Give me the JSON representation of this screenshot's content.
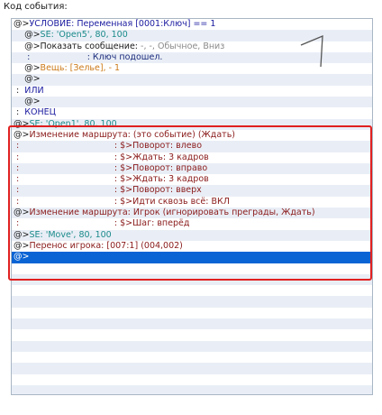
{
  "panel": {
    "title": "Код события:"
  },
  "rows": [
    {
      "bg": "white",
      "segs": [
        [
          "@>",
          "dark"
        ],
        [
          "УСЛОВИЕ: Переменная [0001:Ключ] == 1",
          "blue"
        ]
      ]
    },
    {
      "bg": "alt",
      "segs": [
        [
          "    @>",
          "dark"
        ],
        [
          "SE: 'Open5', 80, 100",
          "teal"
        ]
      ]
    },
    {
      "bg": "white",
      "segs": [
        [
          "    @>Показать сообщение: ",
          "dark"
        ],
        [
          "-, -, Обычное, Вниз",
          "gray"
        ]
      ]
    },
    {
      "bg": "alt",
      "segs": [
        [
          "     :                     : Ключ подошел.",
          "navy"
        ]
      ]
    },
    {
      "bg": "white",
      "segs": [
        [
          "    @>",
          "dark"
        ],
        [
          "Вещь: [Зелье], - 1",
          "orange"
        ]
      ]
    },
    {
      "bg": "alt",
      "segs": [
        [
          "    @>",
          "dark"
        ]
      ]
    },
    {
      "bg": "white",
      "segs": [
        [
          " :  ",
          "dark"
        ],
        [
          "ИЛИ",
          "blue"
        ]
      ]
    },
    {
      "bg": "alt",
      "segs": [
        [
          "    @>",
          "dark"
        ]
      ]
    },
    {
      "bg": "white",
      "segs": [
        [
          " :  ",
          "dark"
        ],
        [
          "КОНЕЦ",
          "blue"
        ]
      ]
    },
    {
      "bg": "alt",
      "segs": [
        [
          "@>",
          "dark"
        ],
        [
          "SE: 'Open1', 80, 100",
          "teal"
        ]
      ]
    },
    {
      "bg": "white",
      "segs": [
        [
          "@>",
          "dark"
        ],
        [
          "Изменение маршрута: (это событие) (Ждать)",
          "maroon"
        ]
      ]
    },
    {
      "bg": "alt",
      "segs": [
        [
          " :                                   : $>Поворот: влево",
          "maroon"
        ]
      ]
    },
    {
      "bg": "white",
      "segs": [
        [
          " :                                   : $>Ждать: 3 кадров",
          "maroon"
        ]
      ]
    },
    {
      "bg": "alt",
      "segs": [
        [
          " :                                   : $>Поворот: вправо",
          "maroon"
        ]
      ]
    },
    {
      "bg": "white",
      "segs": [
        [
          " :                                   : $>Ждать: 3 кадров",
          "maroon"
        ]
      ]
    },
    {
      "bg": "alt",
      "segs": [
        [
          " :                                   : $>Поворот: вверх",
          "maroon"
        ]
      ]
    },
    {
      "bg": "white",
      "segs": [
        [
          " :                                   : $>Идти сквозь всё: ВКЛ",
          "maroon"
        ]
      ]
    },
    {
      "bg": "alt",
      "segs": [
        [
          "@>",
          "dark"
        ],
        [
          "Изменение маршрута: Игрок (игнорировать преграды, Ждать)",
          "maroon"
        ]
      ]
    },
    {
      "bg": "white",
      "segs": [
        [
          " :                                   : $>Шаг: вперёд",
          "maroon"
        ]
      ]
    },
    {
      "bg": "alt",
      "segs": [
        [
          "@>",
          "dark"
        ],
        [
          "SE: 'Move', 80, 100",
          "teal"
        ]
      ]
    },
    {
      "bg": "white",
      "segs": [
        [
          "@>",
          "dark"
        ],
        [
          "Перенос игрока: [007:1] (004,002)",
          "maroon"
        ]
      ]
    },
    {
      "bg": "sel",
      "segs": [
        [
          "@>",
          "white"
        ]
      ]
    },
    {
      "bg": "white",
      "segs": []
    },
    {
      "bg": "alt",
      "segs": []
    },
    {
      "bg": "white",
      "segs": []
    },
    {
      "bg": "alt",
      "segs": []
    },
    {
      "bg": "white",
      "segs": []
    },
    {
      "bg": "alt",
      "segs": []
    },
    {
      "bg": "white",
      "segs": []
    },
    {
      "bg": "alt",
      "segs": []
    },
    {
      "bg": "white",
      "segs": []
    },
    {
      "bg": "alt",
      "segs": []
    },
    {
      "bg": "white",
      "segs": []
    },
    {
      "bg": "alt",
      "segs": []
    }
  ]
}
